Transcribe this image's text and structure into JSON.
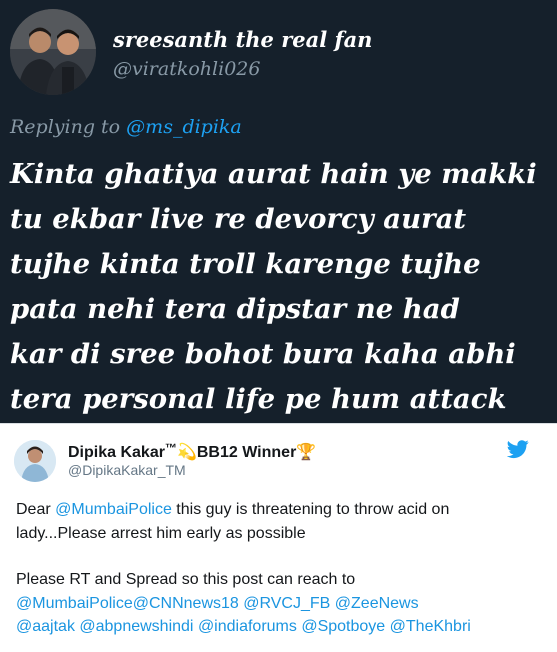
{
  "reply_tweet": {
    "display_name": "sreesanth the real fan",
    "handle": "@viratkohli026",
    "replying_label": "Replying to",
    "replying_to": "@ms_dipika",
    "body_lines": [
      "Kinta ghatiya aurat hain ye makki",
      "tu ekbar live re devorcy aurat",
      "tujhe kinta troll karenge tujhe",
      "pata nehi tera dipstar ne had",
      "kar di sree bohot bura kaha abhi",
      "tera personal life pe hum attack"
    ],
    "background_color": "#15202b"
  },
  "main_tweet": {
    "display_name": "Dipika Kakar",
    "trademark": "™",
    "badge_emoji": "💫",
    "badge_text": "BB12 Winner",
    "trophy_emoji": "🏆",
    "handle": "@DipikaKakar_TM",
    "platform_icon": "twitter-bird-icon",
    "para1": {
      "text_a": "Dear ",
      "mention_a": "@MumbaiPolice",
      "text_b": " this guy is threatening to throw acid on lady...Please arrest him early as possible"
    },
    "para2": "Please RT and Spread so this post can reach to",
    "mention_lines": [
      [
        "@MumbaiPolice",
        "@CNNnews18",
        " ",
        "@RVCJ_FB",
        " ",
        "@ZeeNews"
      ],
      [
        "@aajtak",
        " ",
        "@abpnewshindi",
        " ",
        "@indiaforums",
        " ",
        "@Spotboye",
        " ",
        "@TheKhbri"
      ]
    ],
    "accent_color": "#1da1f2",
    "link_color": "#1b95e0"
  }
}
